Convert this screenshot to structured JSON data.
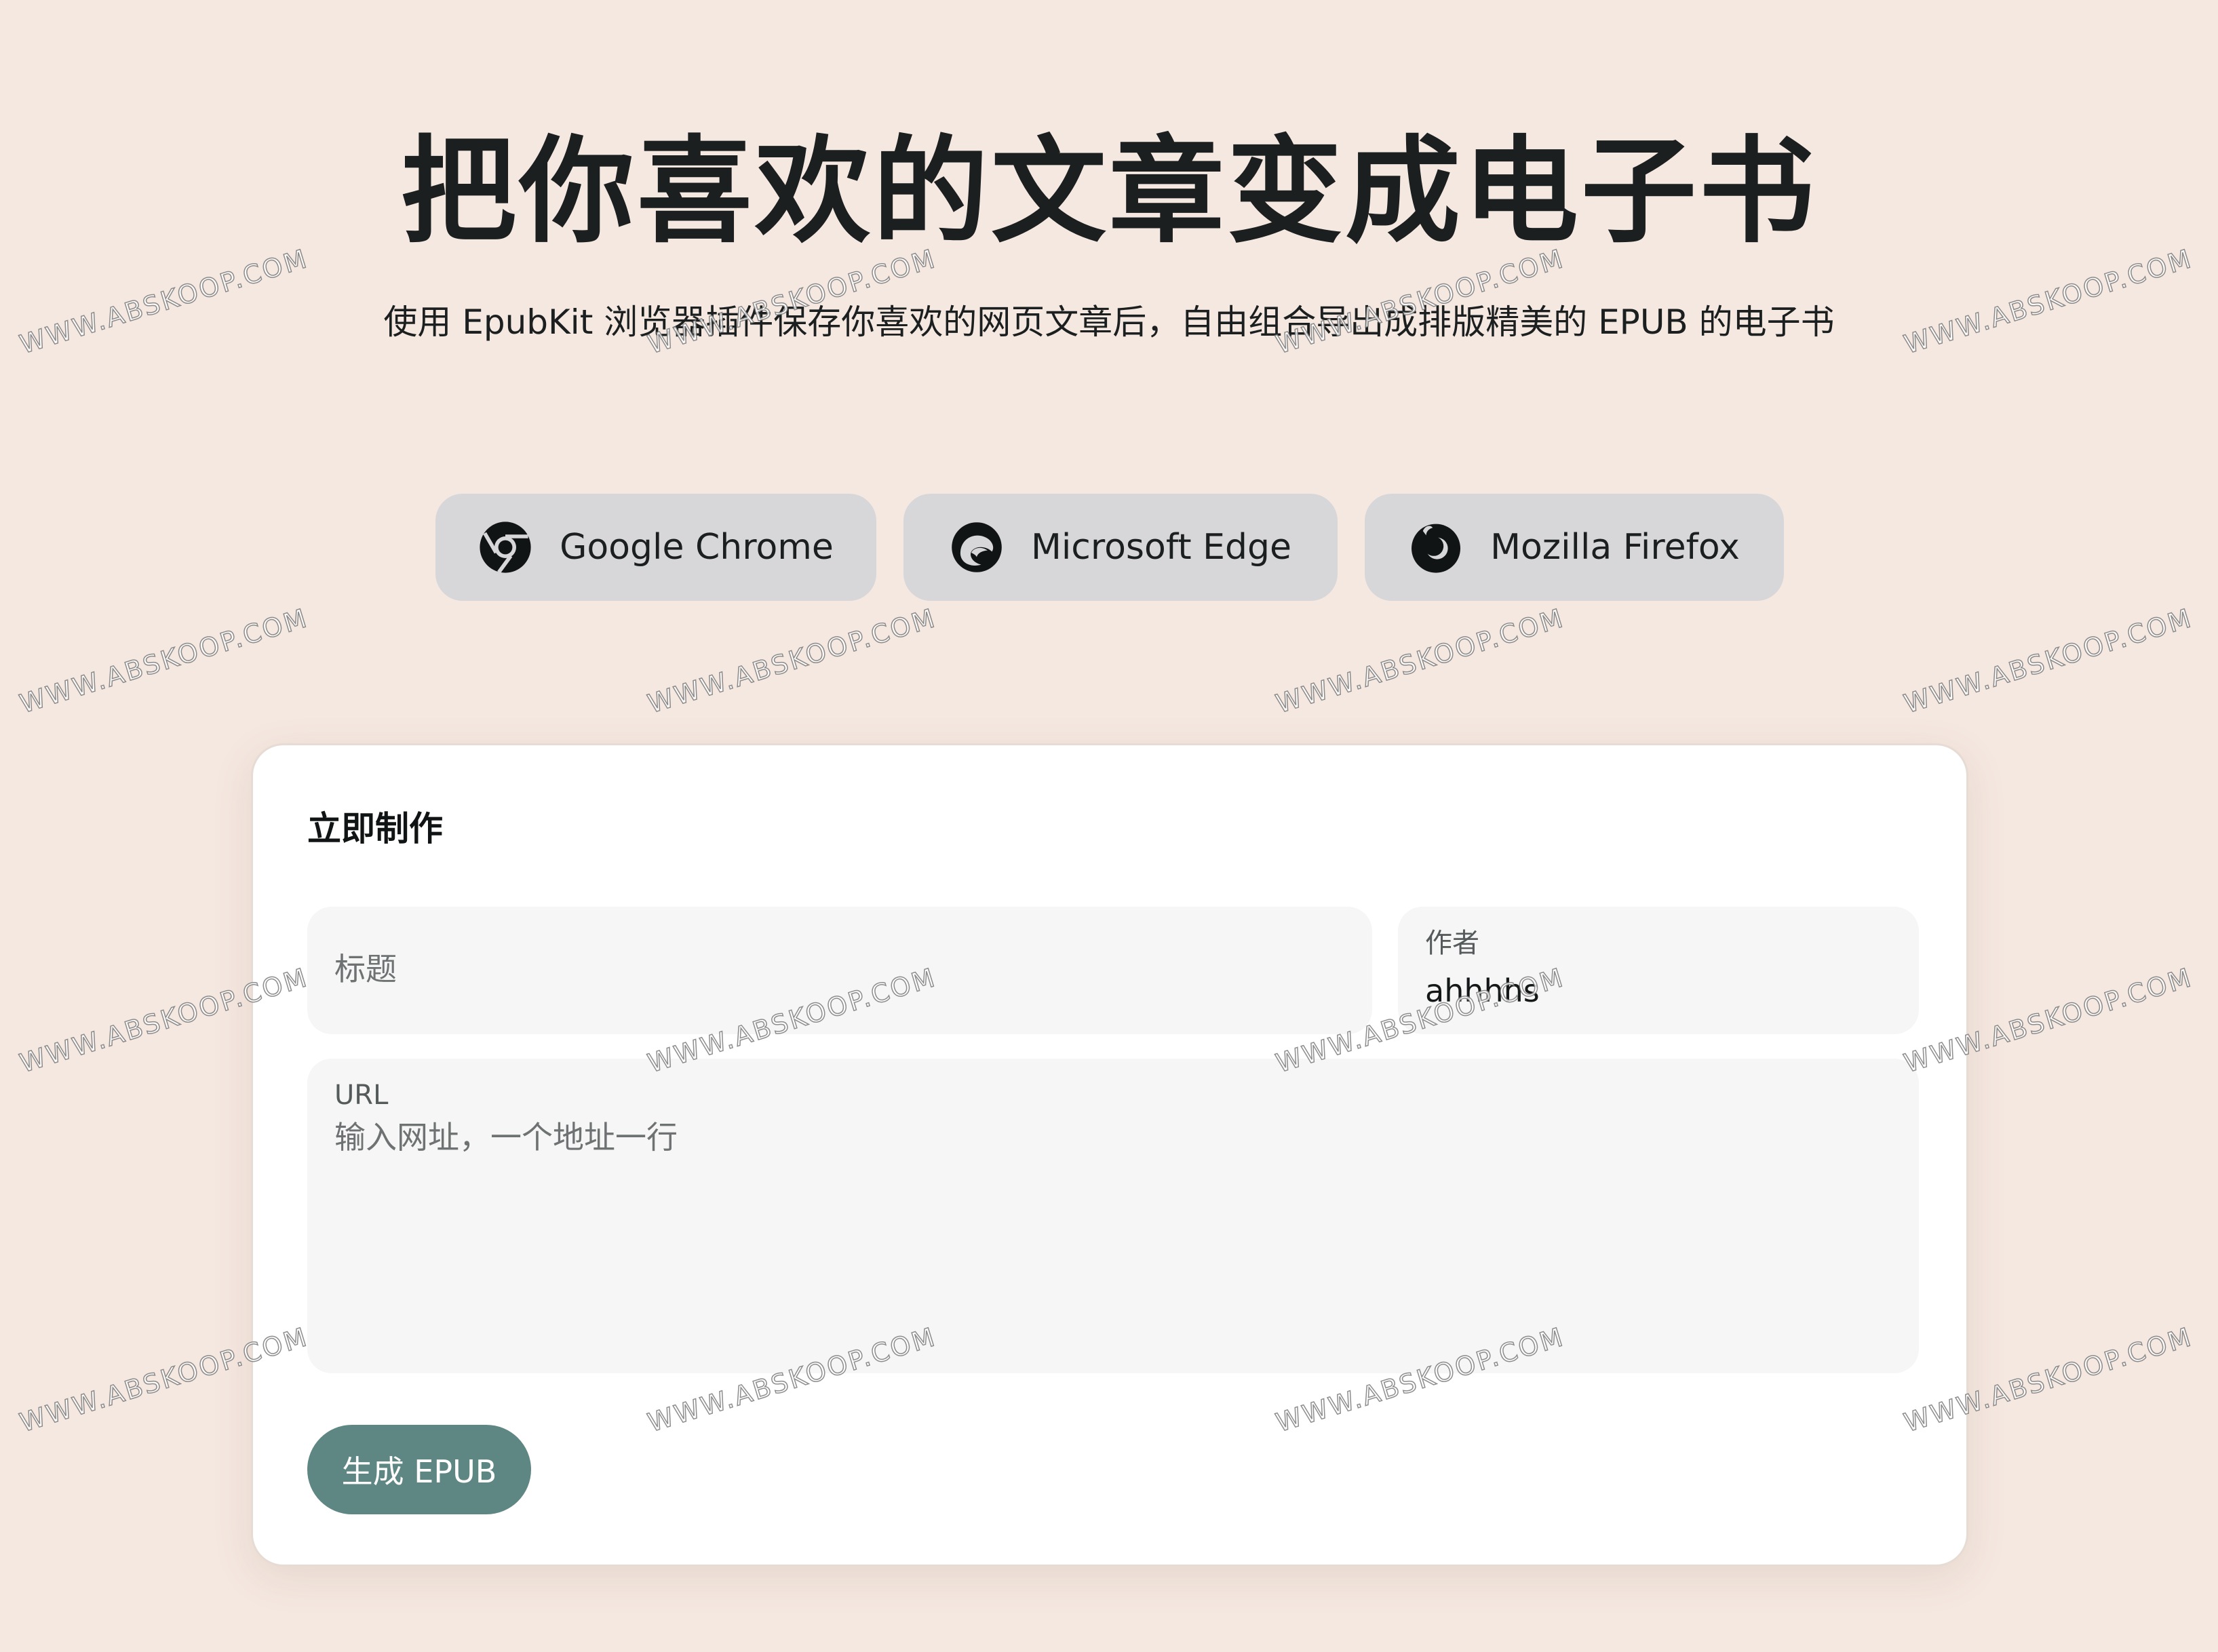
{
  "hero": {
    "title": "把你喜欢的文章变成电子书",
    "subtitle": "使用 EpubKit 浏览器插件保存你喜欢的网页文章后，自由组合导出成排版精美的 EPUB 的电子书"
  },
  "browsers": [
    {
      "label": "Google Chrome",
      "icon": "chrome-icon"
    },
    {
      "label": "Microsoft Edge",
      "icon": "edge-icon"
    },
    {
      "label": "Mozilla Firefox",
      "icon": "firefox-icon"
    }
  ],
  "form": {
    "heading": "立即制作",
    "title_field": {
      "placeholder": "标题",
      "value": ""
    },
    "author_field": {
      "label": "作者",
      "value": "ahhhhs"
    },
    "url_field": {
      "label": "URL",
      "placeholder": "输入网址，一个地址一行",
      "value": ""
    },
    "submit_label": "生成 EPUB"
  },
  "watermark": {
    "text": "WWW.ABSKOOP.COM"
  },
  "colors": {
    "page_background": "#f5e8e0",
    "button_background": "#d7d7da",
    "card_background": "#ffffff",
    "field_background": "#f6f6f6",
    "primary_button": "#5e8784"
  }
}
